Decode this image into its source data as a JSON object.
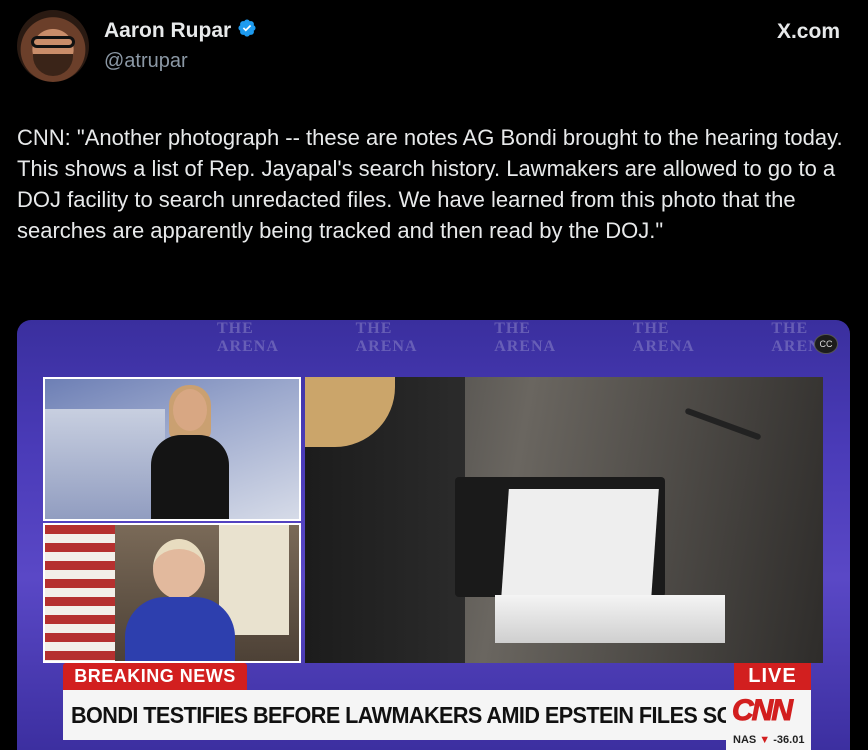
{
  "author": {
    "name": "Aaron Rupar",
    "handle": "@atrupar"
  },
  "brand": "X.com",
  "tweet_text": "CNN: \"Another photograph -- these are notes AG Bondi brought to the hearing today. This shows a list of Rep. Jayapal's search history. Lawmakers are allowed to go to a DOJ facility to search unredacted files. We have learned from this photo that the searches are apparently being tracked and then read by the DOJ.\"",
  "video": {
    "background_text": [
      "THE ARENA",
      "THE ARENA",
      "THE ARENA",
      "THE ARENA",
      "THE ARENA"
    ],
    "cc_label": "CC",
    "breaking_label": "BREAKING NEWS",
    "live_label": "LIVE",
    "headline": "BONDI TESTIFIES BEFORE LAWMAKERS AMID EPSTEIN FILES SCRUTINY",
    "network": "CNN",
    "ticker_symbol": "NAS",
    "ticker_arrow": "▼",
    "ticker_value": "-36.01"
  },
  "colors": {
    "verified": "#1d9bf0",
    "cnn_red": "#d21f1f",
    "background": "#000000"
  }
}
